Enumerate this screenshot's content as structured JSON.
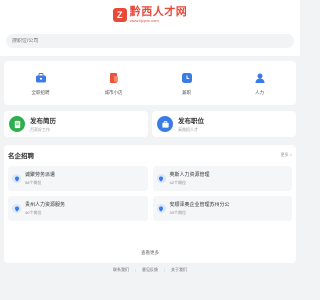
{
  "header": {
    "logo_mark": "Z",
    "logo_name": "黔西人才网",
    "logo_url": "www.bjqxrc.com"
  },
  "search": {
    "placeholder": "搜职位/公司"
  },
  "nav": [
    {
      "label": "全职招聘",
      "icon": "briefcase-icon",
      "color": "#3b7be8"
    },
    {
      "label": "城市小店",
      "icon": "shop-icon",
      "color": "#e8553b"
    },
    {
      "label": "兼职",
      "icon": "clock-icon",
      "color": "#3b7be8"
    },
    {
      "label": "人力",
      "icon": "person-icon",
      "color": "#3b7be8"
    }
  ],
  "publish": [
    {
      "title": "发布简历",
      "subtitle": "百家好工作",
      "icon": "resume-icon",
      "color": "#2fae4d"
    },
    {
      "title": "发布职位",
      "subtitle": "高效招人才",
      "icon": "job-post-icon",
      "color": "#3b7be8"
    }
  ],
  "companies": {
    "title": "名企招聘",
    "more": "更多 >",
    "items": [
      {
        "name": "诚聚劳务派遣",
        "count": "58个岗位"
      },
      {
        "name": "英斯人力资源管理",
        "count": "42个岗位"
      },
      {
        "name": "贵州人力资源服务",
        "count": "40个岗位"
      },
      {
        "name": "安顺泽奥企业管理苏州分公",
        "count": "33个岗位"
      }
    ],
    "see_more": "查看更多"
  },
  "footer": {
    "links": [
      "联系我们",
      "意见反馈",
      "关于我们"
    ]
  }
}
